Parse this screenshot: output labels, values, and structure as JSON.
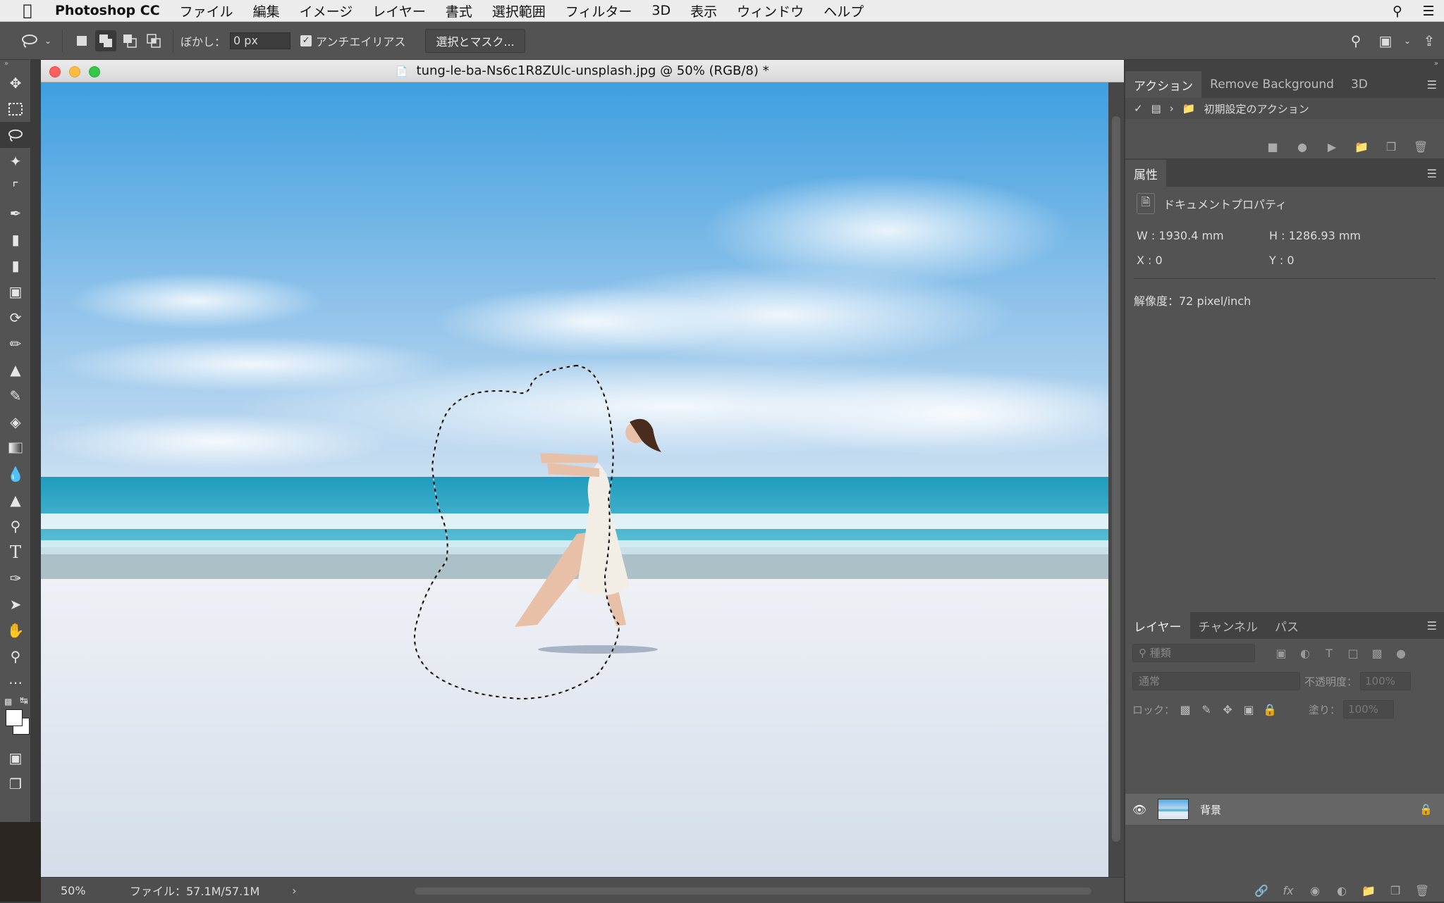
{
  "menubar": {
    "app_name": "Photoshop CC",
    "items": [
      "ファイル",
      "編集",
      "イメージ",
      "レイヤー",
      "書式",
      "選択範囲",
      "フィルター",
      "3D",
      "表示",
      "ウィンドウ",
      "ヘルプ"
    ]
  },
  "options": {
    "feather_label": "ぼかし：",
    "feather_value": "0 px",
    "antialias_label": "アンチエイリアス",
    "select_mask_label": "選択とマスク..."
  },
  "document": {
    "title": "tung-le-ba-Ns6c1R8ZUlc-unsplash.jpg @ 50% (RGB/8) *",
    "zoom": "50%",
    "file_info": "ファイル：57.1M/57.1M"
  },
  "actions_panel": {
    "tabs": [
      "アクション",
      "Remove Background",
      "3D"
    ],
    "set_name": "初期設定のアクション"
  },
  "properties_panel": {
    "tab": "属性",
    "section_title": "ドキュメントプロパティ",
    "w": "W : 1930.4 mm",
    "h": "H : 1286.93 mm",
    "x": "X : 0",
    "y": "Y : 0",
    "resolution": "解像度：72 pixel/inch"
  },
  "layers_panel": {
    "tabs": [
      "レイヤー",
      "チャンネル",
      "パス"
    ],
    "kind_placeholder": "種類",
    "blend_mode": "通常",
    "opacity_label": "不透明度：",
    "opacity_value": "100%",
    "lock_label": "ロック：",
    "fill_label": "塗り：",
    "fill_value": "100%",
    "layer_name": "背景"
  },
  "colors": {
    "sky_top": "#3f9fe0",
    "sea": "#3aa6c4",
    "sand": "#dfe6ef",
    "panel_bg": "#535353"
  }
}
